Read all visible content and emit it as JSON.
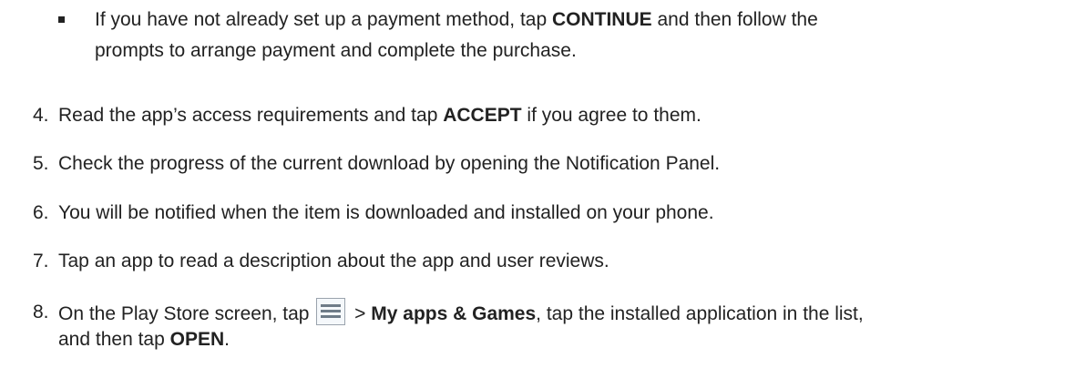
{
  "bullet_item": {
    "line1_a": "If you have not already set up a payment method, tap ",
    "line1_bold": "CONTINUE",
    "line1_b": " and then follow the",
    "line2": "prompts to arrange payment and complete the purchase."
  },
  "steps": [
    {
      "num": "4.",
      "pre": "Read the app’s access requirements and tap ",
      "bold": "ACCEPT",
      "post": " if you agree to them."
    },
    {
      "num": "5.",
      "text": "Check the progress of the current download by opening the Notification Panel."
    },
    {
      "num": "6.",
      "text": "You will be notified when the item is downloaded and installed on your phone."
    },
    {
      "num": "7.",
      "text": "Tap an app to read a description about the app and user reviews."
    },
    {
      "num": "8.",
      "pre": "On the Play Store screen, tap ",
      "icon": "menu-icon",
      "mid": " > ",
      "bold1": "My apps & Games",
      "post1": ", tap the installed application in the list,",
      "line2_pre": "and then tap ",
      "bold2": "OPEN",
      "line2_post": "."
    }
  ]
}
